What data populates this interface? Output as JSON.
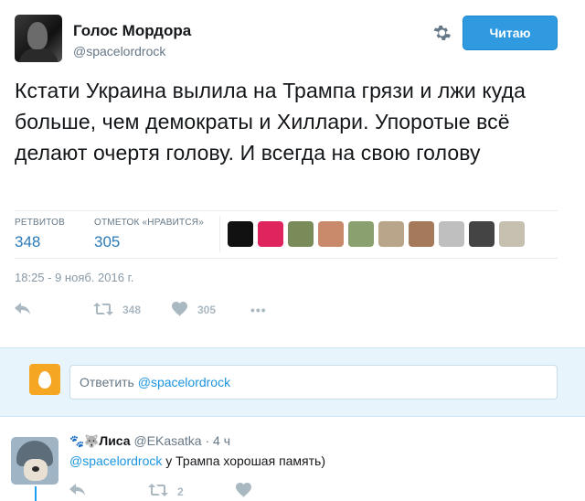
{
  "tweet": {
    "author_name": "Голос Мордора",
    "author_handle": "@spacelordrock",
    "follow_label": "Читаю",
    "text": "Кстати Украина вылила на Трампа грязи и лжи куда больше, чем демократы и Хиллари. Упоротые всё делают очертя голову. И всегда на свою голову",
    "stats": {
      "retweets_label": "РЕТВИТОВ",
      "retweets_count": "348",
      "likes_label": "ОТМЕТОК «НРАВИТСЯ»",
      "likes_count": "305"
    },
    "timestamp": "18:25 - 9 нояб. 2016 г.",
    "actions": {
      "retweet_count": "348",
      "like_count": "305",
      "more_label": "•••"
    },
    "likers": [
      {
        "name": "liker-1",
        "color": "#111111"
      },
      {
        "name": "liker-2",
        "color": "#e0245e"
      },
      {
        "name": "liker-3",
        "color": "#7a8b5a"
      },
      {
        "name": "liker-4",
        "color": "#c98a6b"
      },
      {
        "name": "liker-5",
        "color": "#8aa06e"
      },
      {
        "name": "liker-6",
        "color": "#b9a58a"
      },
      {
        "name": "liker-7",
        "color": "#a57a5a"
      },
      {
        "name": "liker-8",
        "color": "#bfbfbf"
      },
      {
        "name": "liker-9",
        "color": "#444444"
      },
      {
        "name": "liker-10",
        "color": "#c5c0b0"
      }
    ]
  },
  "reply_box": {
    "prefix": "Ответить ",
    "mention": "@spacelordrock"
  },
  "reply": {
    "emoji": "🐾🐺",
    "name": "Лиса",
    "handle": "@EKasatka",
    "time": "· 4 ч",
    "mention": "@spacelordrock",
    "text": " у Трампа хорошая память)",
    "retweet_count": "2"
  },
  "colors": {
    "accent": "#1b95e0",
    "follow_button": "#2f9ae0",
    "reply_bg": "#e8f4fb",
    "muted": "#657786"
  }
}
